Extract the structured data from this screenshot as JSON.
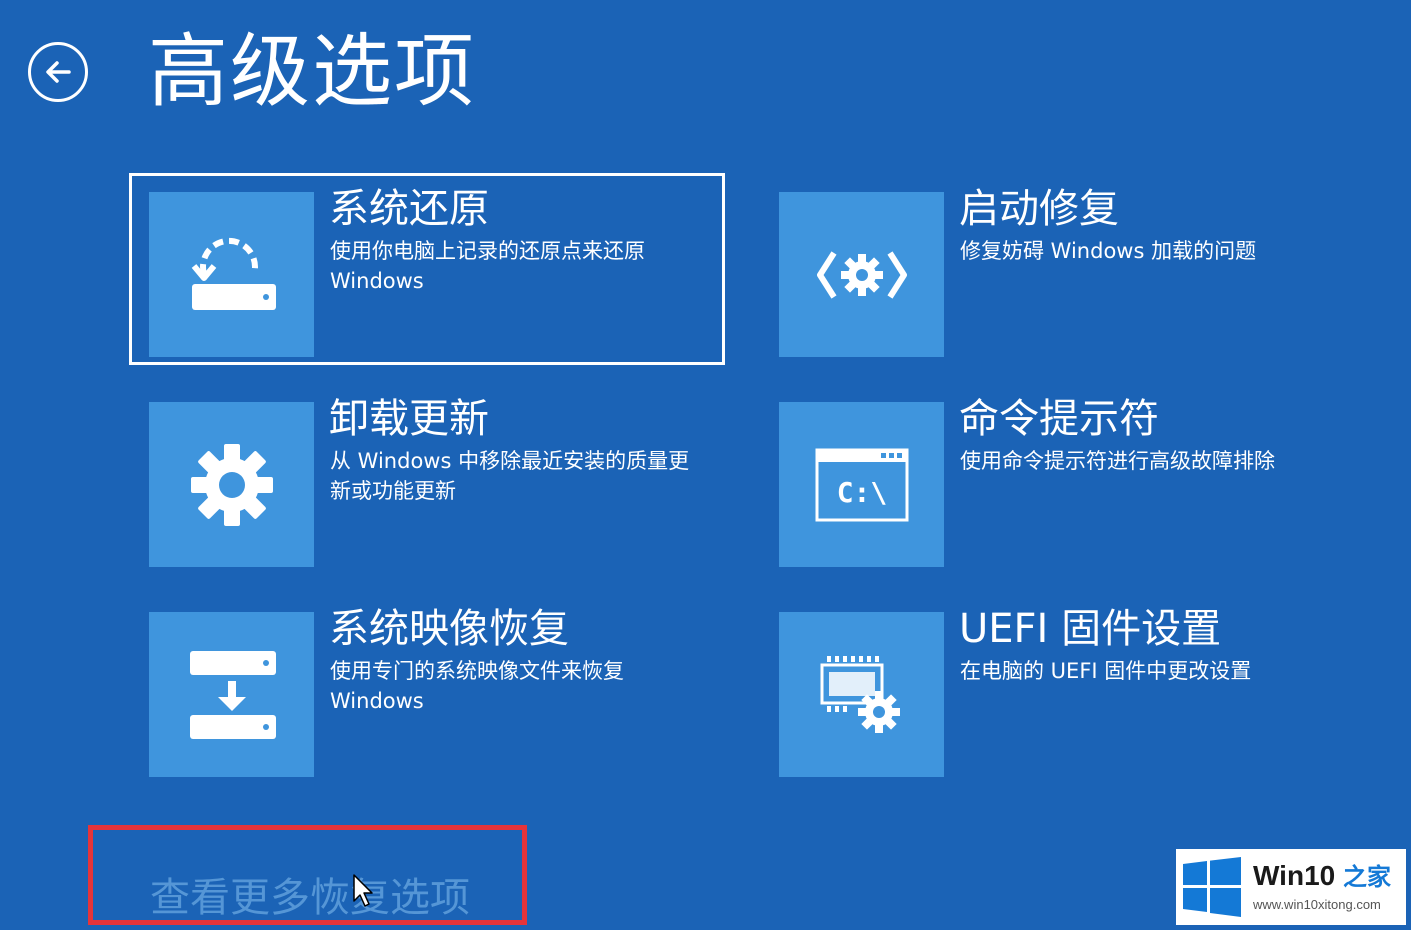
{
  "header": {
    "title": "高级选项",
    "back_icon": "back-arrow-icon"
  },
  "options": [
    {
      "id": "system-restore",
      "title": "系统还原",
      "description": "使用你电脑上记录的还原点来还原 Windows",
      "icon": "restore-icon",
      "selected": true
    },
    {
      "id": "startup-repair",
      "title": "启动修复",
      "description": "修复妨碍 Windows 加载的问题",
      "icon": "startup-repair-icon",
      "selected": false
    },
    {
      "id": "uninstall-updates",
      "title": "卸载更新",
      "description": "从 Windows 中移除最近安装的质量更新或功能更新",
      "icon": "gear-icon",
      "selected": false
    },
    {
      "id": "command-prompt",
      "title": "命令提示符",
      "description": "使用命令提示符进行高级故障排除",
      "icon": "command-prompt-icon",
      "icon_text": "C:\\",
      "selected": false
    },
    {
      "id": "system-image-recovery",
      "title": "系统映像恢复",
      "description": "使用专门的系统映像文件来恢复 Windows",
      "icon": "image-recovery-icon",
      "selected": false
    },
    {
      "id": "uefi-settings",
      "title": "UEFI 固件设置",
      "description": "在电脑的 UEFI 固件中更改设置",
      "icon": "uefi-chip-icon",
      "selected": false
    }
  ],
  "more_link": "查看更多恢复选项",
  "watermark": {
    "brand": "Win10",
    "brand_suffix": "之家",
    "url": "www.win10xitong.com"
  },
  "colors": {
    "background": "#1b63b6",
    "tile_icon_bg": "#3f95dd",
    "highlight": "#e5343a",
    "link_dim": "#5596d6"
  }
}
